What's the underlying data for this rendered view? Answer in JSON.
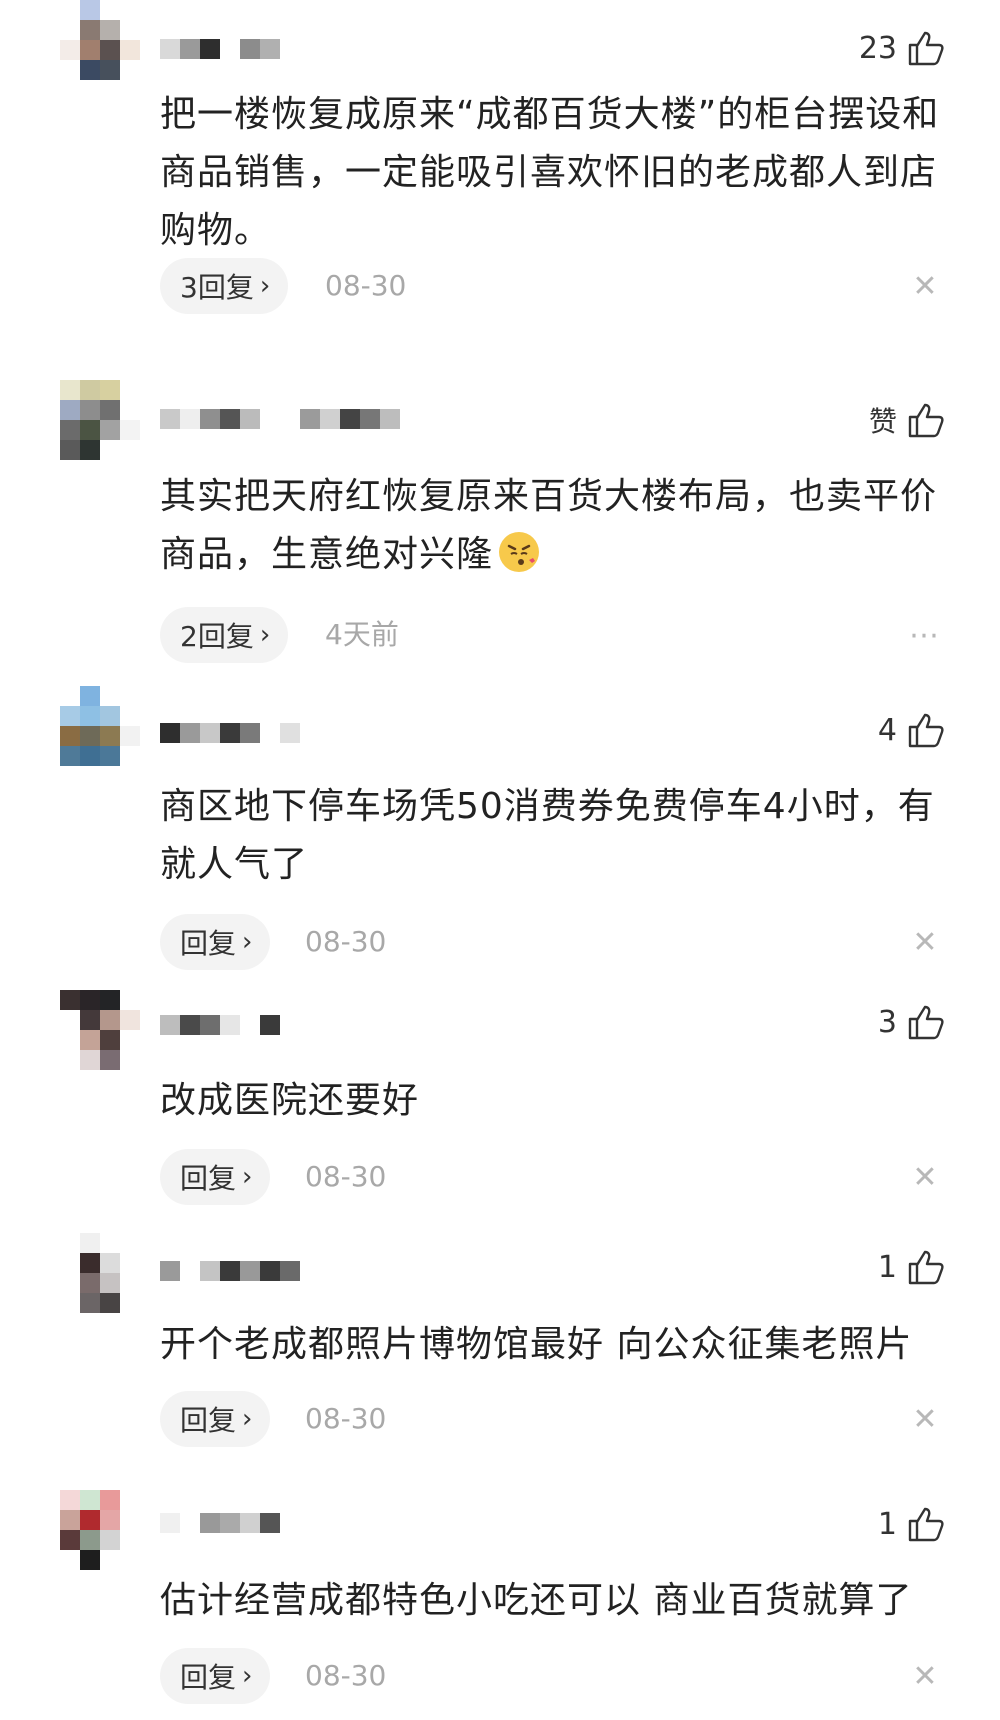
{
  "comments": [
    {
      "likes": "23",
      "text": "把一楼恢复成原来“成都百货大楼”的柜台摆设和商品销售，一定能吸引喜欢怀旧的老成都人到店购物。",
      "reply_label": "3回复",
      "time": "08-30",
      "action_icon": "close-icon"
    },
    {
      "likes": "赞",
      "text": "其实把天府红恢复原来百货大楼布局，也卖平价商品，生意绝对兴隆",
      "emoji": "face-blowing-kiss-emoji",
      "reply_label": "2回复",
      "time": "4天前",
      "action_icon": "more-icon"
    },
    {
      "likes": "4",
      "text": "商区地下停车场凭50消费券免费停车4小时，有就人气了",
      "reply_label": "回复",
      "time": "08-30",
      "action_icon": "close-icon"
    },
    {
      "likes": "3",
      "text": "改成医院还要好",
      "reply_label": "回复",
      "time": "08-30",
      "action_icon": "close-icon"
    },
    {
      "likes": "1",
      "text": "开个老成都照片博物馆最好 向公众征集老照片",
      "reply_label": "回复",
      "time": "08-30",
      "action_icon": "close-icon"
    },
    {
      "likes": "1",
      "text": "估计经营成都特色小吃还可以 商业百货就算了",
      "reply_label": "回复",
      "time": "08-30",
      "action_icon": "close-icon"
    }
  ],
  "colors": {
    "text": "#222222",
    "muted": "#a8a8a8",
    "pill_bg": "#f3f3f3",
    "icon": "#333333"
  },
  "icons": {
    "like": "thumbs-up-icon",
    "reply_arrow": "chevron-right-icon",
    "close": "close-icon",
    "more": "more-icon"
  }
}
